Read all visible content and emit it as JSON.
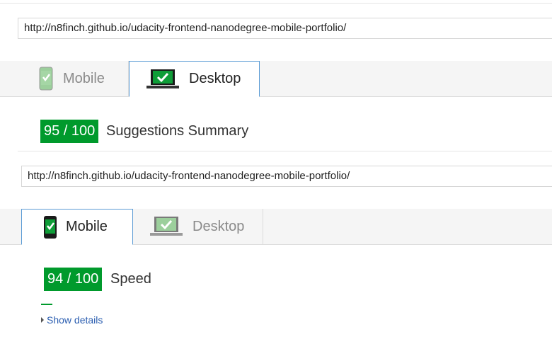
{
  "top": {
    "url": "http://n8finch.github.io/udacity-frontend-nanodegree-mobile-portfolio/",
    "tabs": [
      {
        "label": "Mobile",
        "active": false
      },
      {
        "label": "Desktop",
        "active": true
      }
    ],
    "score": "95 / 100",
    "score_title": "Suggestions Summary"
  },
  "bottom": {
    "url": "http://n8finch.github.io/udacity-frontend-nanodegree-mobile-portfolio/",
    "tabs": [
      {
        "label": "Mobile",
        "active": true
      },
      {
        "label": "Desktop",
        "active": false
      }
    ],
    "score": "94 / 100",
    "score_title": "Speed",
    "details_link": "Show details"
  },
  "colors": {
    "score_green": "#009a2c",
    "active_tab_border": "#5b9bd5",
    "link": "#2a5db0"
  }
}
